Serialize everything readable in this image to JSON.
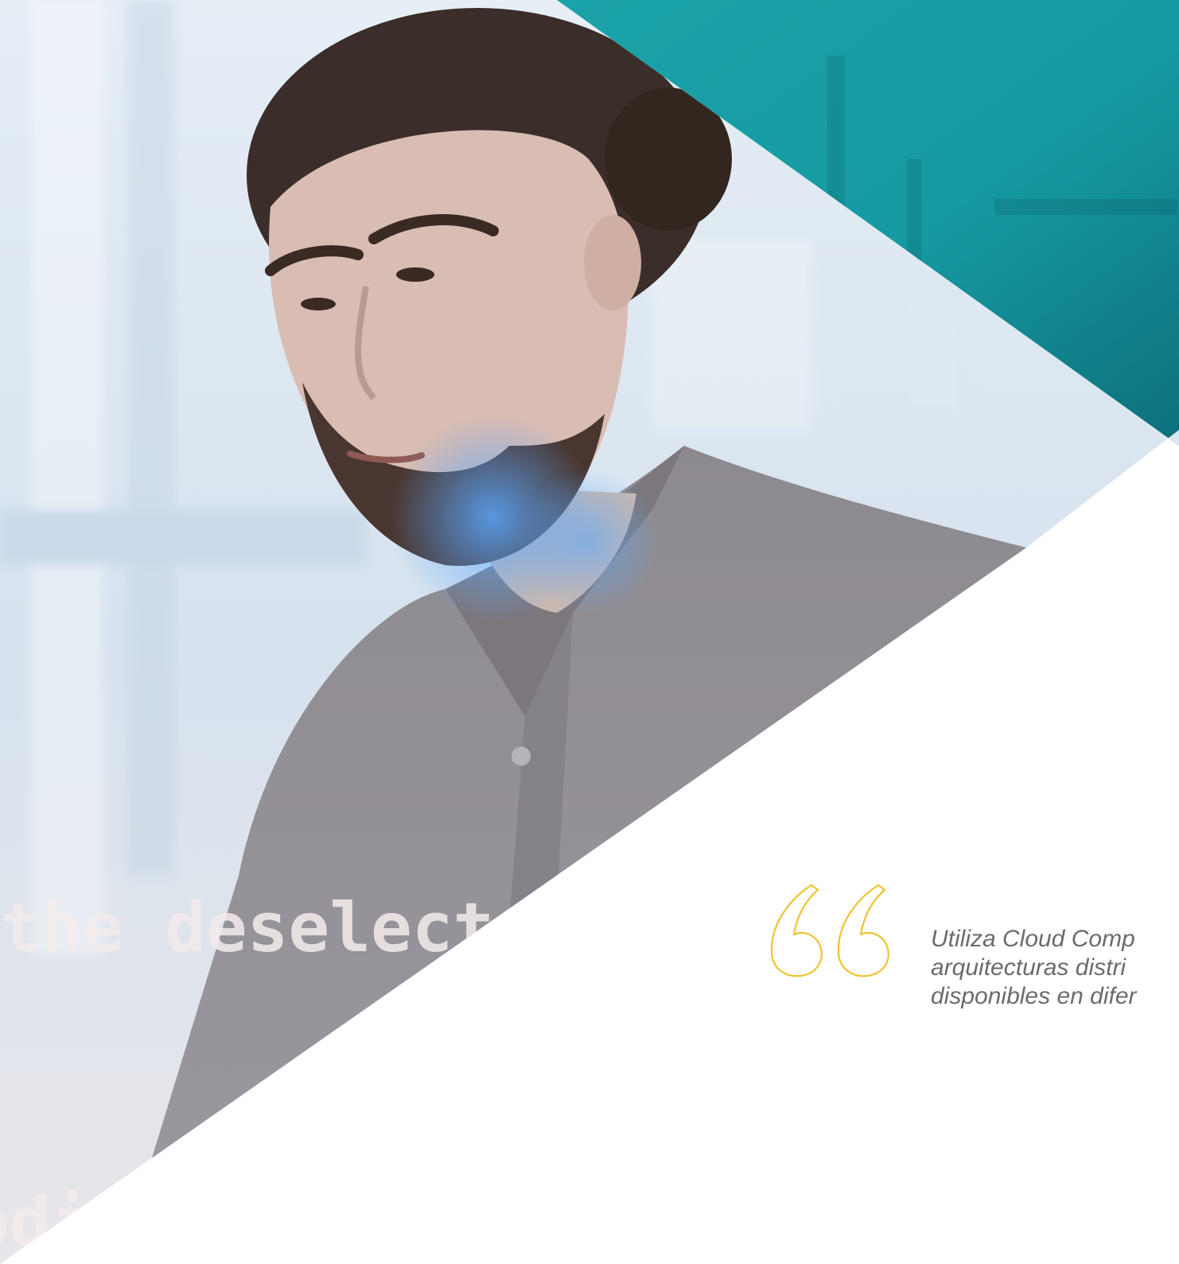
{
  "colors": {
    "teal_accent": "#1aa3a8",
    "teal_dark": "#0e6f7a",
    "quote_yellow": "#f2c230",
    "quote_text": "#6b6b6b",
    "background": "#ffffff"
  },
  "hero": {
    "photo_subject": "bearded man with hair bun in grey shirt",
    "overlay_code_line_1": "the deselecte",
    "overlay_code_line_2": "odif"
  },
  "quote": {
    "icon": "quote-mark-icon",
    "lines": [
      "Utiliza Cloud Comp",
      "arquitecturas distri",
      "disponibles en difer"
    ]
  }
}
